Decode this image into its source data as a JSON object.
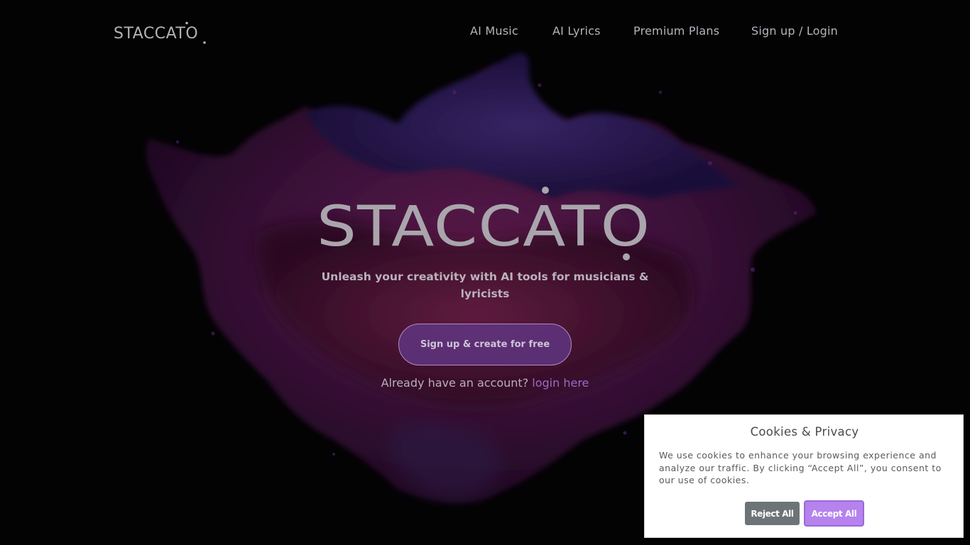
{
  "brand": {
    "name": "STACCATO",
    "logo_color": "#b4b0b7"
  },
  "nav": {
    "items": [
      {
        "label": "AI Music"
      },
      {
        "label": "AI Lyrics"
      },
      {
        "label": "Premium Plans"
      },
      {
        "label": "Sign up / Login"
      }
    ]
  },
  "hero": {
    "title": "STACCATO",
    "tagline": "Unleash your creativity with AI tools for musicians & lyricists",
    "cta_label": "Sign up & create for free",
    "already_text": "Already have an account?",
    "login_link": "login here"
  },
  "cookie": {
    "title": "Cookies & Privacy",
    "text": "We use cookies to enhance your browsing experience and analyze our traffic. By clicking “Accept All”, you consent to our use of cookies.",
    "reject_label": "Reject All",
    "accept_label": "Accept All"
  },
  "colors": {
    "background": "#040305",
    "accent": "#b582ee",
    "link": "#9a6cc2",
    "cta_fill": "#603682"
  }
}
